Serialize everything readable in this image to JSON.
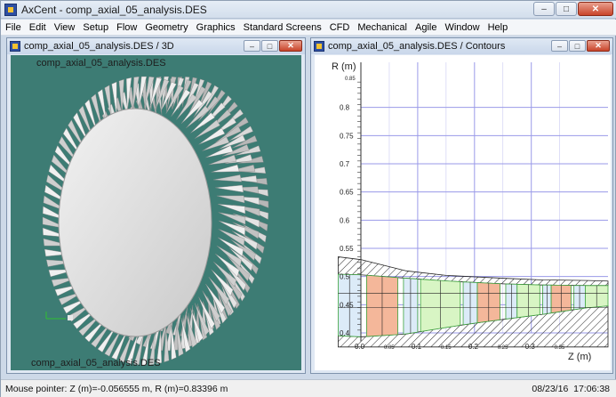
{
  "app": {
    "title": "AxCent - comp_axial_05_analysis.DES"
  },
  "window_buttons": {
    "minimize": "–",
    "maximize": "□",
    "close": "✕"
  },
  "menu": [
    "File",
    "Edit",
    "View",
    "Setup",
    "Flow",
    "Geometry",
    "Graphics",
    "Standard Screens",
    "CFD",
    "Mechanical",
    "Agile",
    "Window",
    "Help"
  ],
  "view3d": {
    "title": "comp_axial_05_analysis.DES / 3D",
    "label_top": "comp_axial_05_analysis.DES",
    "label_bottom": "comp_axial_05_analysis.DES"
  },
  "contours": {
    "title": "comp_axial_05_analysis.DES / Contours",
    "r_axis_label": "R (m)",
    "z_axis_label": "Z (m)",
    "r_major_ticks": [
      "0.8",
      "0.75",
      "0.7",
      "0.65",
      "0.6",
      "0.55",
      "0.5",
      "0.45",
      "0.4"
    ],
    "r_top_tick": "0.85",
    "z_major_ticks": [
      "0.0",
      "0.1",
      "0.2",
      "0.3"
    ],
    "z_minor_ticks": [
      "0.05",
      "0.15",
      "0.25",
      "0.35"
    ]
  },
  "status": {
    "pointer": "Mouse pointer: Z (m)=-0.056555 m, R (m)=0.83396 m",
    "date": "08/23/16",
    "time": "17:06:38"
  }
}
